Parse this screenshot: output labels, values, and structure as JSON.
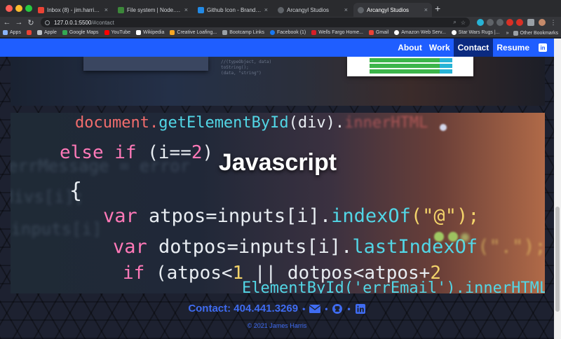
{
  "browser": {
    "tabs": [
      {
        "title": "Inbox (8) - jim.harris@creativ",
        "favicon_color": "#ea4335",
        "active": false
      },
      {
        "title": "File system | Node.js v15.14.0",
        "favicon_color": "#3c873a",
        "active": false
      },
      {
        "title": "Github Icon - Brands | Font Aw",
        "favicon_color": "#228ae6",
        "active": false
      },
      {
        "title": "Arcangyl Studios",
        "favicon_color": "#5f6368",
        "active": false
      },
      {
        "title": "Arcangyl Studios",
        "favicon_color": "#5f6368",
        "active": true
      }
    ],
    "new_tab_label": "+",
    "url_host": "127.0.0.1:5500",
    "url_path": "/#contact",
    "bookmarks": [
      {
        "label": "Apps",
        "color": "#8ab4f8"
      },
      {
        "label": "",
        "color": "#ea4335"
      },
      {
        "label": "Apple",
        "color": "#bdc1c6"
      },
      {
        "label": "Google Maps",
        "color": "#34a853"
      },
      {
        "label": "YouTube",
        "color": "#ff0000"
      },
      {
        "label": "Wikipedia",
        "color": "#ffffff"
      },
      {
        "label": "Creative Loafing...",
        "color": "#f5a623"
      },
      {
        "label": "Bootcamp Links",
        "color": "#9aa0a6"
      },
      {
        "label": "Facebook (1)",
        "color": "#1877f2"
      },
      {
        "label": "Wells Fargo Home...",
        "color": "#d71e28"
      },
      {
        "label": "Gmail",
        "color": "#ea4335"
      },
      {
        "label": "Amazon Web Serv...",
        "color": "#ffffff"
      },
      {
        "label": "Star Wars Rugs |...",
        "color": "#ffffff"
      }
    ],
    "bookmarks_overflow": "»",
    "other_bookmarks": "Other Bookmarks"
  },
  "site": {
    "nav": [
      {
        "label": "About",
        "current": false
      },
      {
        "label": "Work",
        "current": false
      },
      {
        "label": "Contact",
        "current": true
      },
      {
        "label": "Resume",
        "current": false
      }
    ],
    "nav_icon": "linkedin-icon",
    "card_title": "Javascript",
    "code_lines": {
      "l1a": "document.",
      "l1b": "getElementById",
      "l1c": "(div).",
      "l1d": "innerHTML",
      "l2a": "else if ",
      "l2b": "(i==",
      "l2c": "2",
      "l2d": ")",
      "l3": "{",
      "l4a": "var ",
      "l4b": "atpos=inputs[i].",
      "l4c": "indexOf",
      "l4d": "(\"@\");",
      "l5a": "var ",
      "l5b": "dotpos=inputs[i].",
      "l5c": "lastIndexOf",
      "l5d": "(\".\");",
      "l6a": "if ",
      "l6b": "(atpos<",
      "l6c": "1",
      "l6d": " || dotpos<atpos+",
      "l6e": "2",
      "l7": "ElementById('errEmail').innerHTML",
      "bg1": "errMessage = error",
      "bg2": "divs[i];",
      "bg3": "(inputs[i]",
      "top1": "//(typeObject, data)",
      "top2": "toString();",
      "top3": "(data, \"string\")"
    },
    "footer": {
      "contact_text": "Contact: 404.441.3269",
      "separator": "•",
      "icons": [
        "envelope-icon",
        "github-icon",
        "linkedin-icon"
      ],
      "copyright": "© 2021 James Harris"
    }
  },
  "colors": {
    "nav_bg": "#1f5eff",
    "nav_current_bg": "#0b2a80",
    "footer_text": "#3f6cf2"
  }
}
